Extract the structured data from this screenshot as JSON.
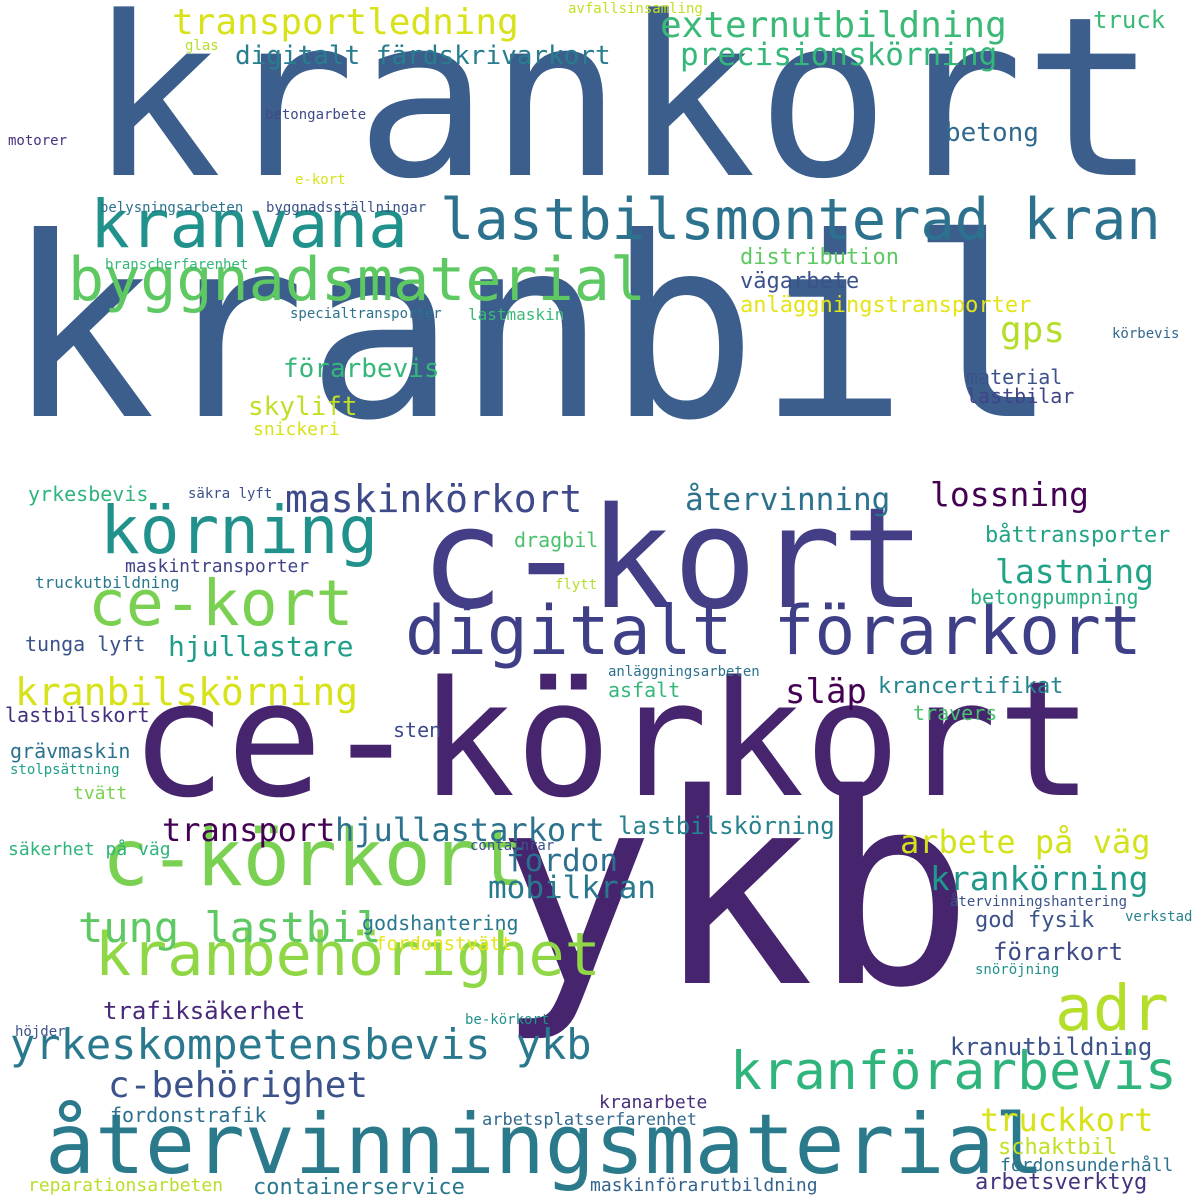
{
  "words": [
    {
      "id": "kranbil",
      "text": "kranbil",
      "color": "#3b5e8c"
    },
    {
      "id": "krankort",
      "text": "krankort",
      "color": "#3b5e8c"
    },
    {
      "id": "ykb",
      "text": "ykb",
      "color": "#46256e"
    },
    {
      "id": "ce-korkort",
      "text": "ce-körkort",
      "color": "#46256e"
    },
    {
      "id": "c-kort",
      "text": "c-kort",
      "color": "#433e85"
    },
    {
      "id": "digitalt-forarkort",
      "text": "digitalt förarkort",
      "color": "#3f3f87"
    },
    {
      "id": "atervinningsmaterial",
      "text": "återvinningsmaterial",
      "color": "#2a7a8c"
    },
    {
      "id": "lastbilsmonterad-kran",
      "text": "lastbilsmonterad kran",
      "color": "#2c728e"
    },
    {
      "id": "kranvana",
      "text": "kranvana",
      "color": "#21918c"
    },
    {
      "id": "byggnadsmaterial",
      "text": "byggnadsmaterial",
      "color": "#5ec962"
    },
    {
      "id": "korning",
      "text": "körning",
      "color": "#21918c"
    },
    {
      "id": "ce-kort",
      "text": "ce-kort",
      "color": "#7ad151"
    },
    {
      "id": "c-korkort",
      "text": "c-körkort",
      "color": "#7ad151"
    },
    {
      "id": "kranforarbevis",
      "text": "kranförarbevis",
      "color": "#2fb47c"
    },
    {
      "id": "adr",
      "text": "adr",
      "color": "#b5de2b"
    },
    {
      "id": "kranbehorighet",
      "text": "kranbehörighet",
      "color": "#8fd744"
    },
    {
      "id": "yrkeskompetensbevis-ykb",
      "text": "yrkeskompetensbevis ykb",
      "color": "#2a788e"
    },
    {
      "id": "tung-lastbil",
      "text": "tung lastbil",
      "color": "#5ec962"
    },
    {
      "id": "transportledning",
      "text": "transportledning",
      "color": "#d8e219"
    },
    {
      "id": "externutbildning",
      "text": "externutbildning",
      "color": "#3aba76"
    },
    {
      "id": "maskinkorkort",
      "text": "maskinkörkort",
      "color": "#3e4989"
    },
    {
      "id": "kranbilskorning",
      "text": "kranbilskörning",
      "color": "#d8e219"
    },
    {
      "id": "c-behorighet",
      "text": "c-behörighet",
      "color": "#3b528b"
    },
    {
      "id": "transport",
      "text": "transport",
      "color": "#440154"
    },
    {
      "id": "hjullastarkort",
      "text": "hjullastarkort",
      "color": "#2c728e"
    },
    {
      "id": "precisionskorning",
      "text": "precisionskörning",
      "color": "#35b779"
    },
    {
      "id": "digitalt-fardskrivarkort",
      "text": "digitalt färdskrivarkort",
      "color": "#287d8e"
    },
    {
      "id": "lossning",
      "text": "lossning",
      "color": "#440154"
    },
    {
      "id": "lastning",
      "text": "lastning",
      "color": "#20a386"
    },
    {
      "id": "atervinning",
      "text": "återvinning",
      "color": "#2c728e"
    },
    {
      "id": "krankorning",
      "text": "krankörning",
      "color": "#1f9a8a"
    },
    {
      "id": "arbete-pa-vag",
      "text": "arbete på väg",
      "color": "#d2e21b"
    },
    {
      "id": "truckkort",
      "text": "truckkort",
      "color": "#d8e219"
    },
    {
      "id": "mobilkran",
      "text": "mobilkran",
      "color": "#2a788e"
    },
    {
      "id": "fordon",
      "text": "fordon",
      "color": "#2d708e"
    },
    {
      "id": "hjullastare",
      "text": "hjullastare",
      "color": "#1f9e89"
    },
    {
      "id": "slap",
      "text": "släp",
      "color": "#440154"
    },
    {
      "id": "gps",
      "text": "gps",
      "color": "#b5de2b"
    },
    {
      "id": "forarbevis",
      "text": "förarbevis",
      "color": "#35b779"
    },
    {
      "id": "skylift",
      "text": "skylift",
      "color": "#c0df25"
    },
    {
      "id": "distribution",
      "text": "distribution",
      "color": "#5ec962"
    },
    {
      "id": "vagarbete",
      "text": "vägarbete",
      "color": "#3b528b"
    },
    {
      "id": "anlaggningstransporter",
      "text": "anläggningstransporter",
      "color": "#e5e419"
    },
    {
      "id": "betong",
      "text": "betong",
      "color": "#31688e"
    },
    {
      "id": "truck",
      "text": "truck",
      "color": "#3aba76"
    },
    {
      "id": "material",
      "text": "material",
      "color": "#3b528b"
    },
    {
      "id": "lastbilar",
      "text": "lastbilar",
      "color": "#414487"
    },
    {
      "id": "battransporter",
      "text": "båttransporter",
      "color": "#20a386"
    },
    {
      "id": "betongpumpning",
      "text": "betongpumpning",
      "color": "#29af7f"
    },
    {
      "id": "krancertifikat",
      "text": "krancertifikat",
      "color": "#24868e"
    },
    {
      "id": "travers",
      "text": "travers",
      "color": "#4ac16d"
    },
    {
      "id": "god-fysik",
      "text": "god fysik",
      "color": "#3b528b"
    },
    {
      "id": "forarkort",
      "text": "förarkort",
      "color": "#3e4a89"
    },
    {
      "id": "kranutbildning",
      "text": "kranutbildning",
      "color": "#3b528b"
    },
    {
      "id": "schaktbil",
      "text": "schaktbil",
      "color": "#c2df23"
    },
    {
      "id": "fordonsunderhall",
      "text": "fordonsunderhåll",
      "color": "#2c728e"
    },
    {
      "id": "arbetsverktyg",
      "text": "arbetsverktyg",
      "color": "#46327e"
    },
    {
      "id": "kranarbete",
      "text": "kranarbete",
      "color": "#472d7b"
    },
    {
      "id": "arbetsplatserfarenhet",
      "text": "arbetsplatserfarenhet",
      "color": "#31688e"
    },
    {
      "id": "maskinforarutbildning",
      "text": "maskinförarutbildning",
      "color": "#33638d"
    },
    {
      "id": "containerservice",
      "text": "containerservice",
      "color": "#2a788e"
    },
    {
      "id": "reparationsarbeten",
      "text": "reparationsarbeten",
      "color": "#b8de29"
    },
    {
      "id": "fordonstrafik",
      "text": "fordonstrafik",
      "color": "#2d708e"
    },
    {
      "id": "trafiksakerhet",
      "text": "trafiksäkerhet",
      "color": "#482878"
    },
    {
      "id": "lastbilskorning",
      "text": "lastbilskörning",
      "color": "#26828e"
    },
    {
      "id": "godshantering",
      "text": "godshantering",
      "color": "#2a788e"
    },
    {
      "id": "fordonstvatt",
      "text": "fordonstvätt",
      "color": "#e5e419"
    },
    {
      "id": "yrkesbevis",
      "text": "yrkesbevis",
      "color": "#2fb47c"
    },
    {
      "id": "sakra-lyft",
      "text": "säkra lyft",
      "color": "#3b528b"
    },
    {
      "id": "dragbil",
      "text": "dragbil",
      "color": "#4ac16d"
    },
    {
      "id": "maskintransporter",
      "text": "maskintransporter",
      "color": "#414487"
    },
    {
      "id": "truckutbildning",
      "text": "truckutbildning",
      "color": "#2a788e"
    },
    {
      "id": "flytt",
      "text": "flytt",
      "color": "#b5de2b"
    },
    {
      "id": "tunga-lyft",
      "text": "tunga lyft",
      "color": "#3b528b"
    },
    {
      "id": "anlaggningsarbeten",
      "text": "anläggningsarbeten",
      "color": "#2c728e"
    },
    {
      "id": "asfalt",
      "text": "asfalt",
      "color": "#35b779"
    },
    {
      "id": "lastbilskort",
      "text": "lastbilskort",
      "color": "#46307e"
    },
    {
      "id": "sten",
      "text": "sten",
      "color": "#3e4a89"
    },
    {
      "id": "gravmaskin",
      "text": "grävmaskin",
      "color": "#2c728e"
    },
    {
      "id": "stolpsattning",
      "text": "stolpsättning",
      "color": "#1fa088"
    },
    {
      "id": "tvatt",
      "text": "tvätt",
      "color": "#7ad151"
    },
    {
      "id": "sakerhet-pa-vag",
      "text": "säkerhet på väg",
      "color": "#2fb47c"
    },
    {
      "id": "containrar",
      "text": "containrar",
      "color": "#3b528b"
    },
    {
      "id": "atervinningshantering",
      "text": "återvinningshantering",
      "color": "#3b528b"
    },
    {
      "id": "verkstad",
      "text": "verkstad",
      "color": "#26828e"
    },
    {
      "id": "snorojning",
      "text": "snöröjning",
      "color": "#21918c"
    },
    {
      "id": "hojder",
      "text": "höjder",
      "color": "#3b528b"
    },
    {
      "id": "be-korkort",
      "text": "be-körkort",
      "color": "#21918c"
    },
    {
      "id": "avfallsinsamling",
      "text": "avfallsinsamling",
      "color": "#c2df23"
    },
    {
      "id": "glas",
      "text": "glas",
      "color": "#b5de2b"
    },
    {
      "id": "betongarbete",
      "text": "betongarbete",
      "color": "#3e4989"
    },
    {
      "id": "motorer",
      "text": "motorer",
      "color": "#46327e"
    },
    {
      "id": "e-kort",
      "text": "e-kort",
      "color": "#d8e219"
    },
    {
      "id": "belysningsarbeten",
      "text": "belysningsarbeten",
      "color": "#2c728e"
    },
    {
      "id": "byggnadsstallningar",
      "text": "byggnadsställningar",
      "color": "#3b528b"
    },
    {
      "id": "branscherfarenhet",
      "text": "branscherfarenhet",
      "color": "#35b779"
    },
    {
      "id": "specialtransporter",
      "text": "specialtransporter",
      "color": "#2c728e"
    },
    {
      "id": "lastmaskin",
      "text": "lastmaskin",
      "color": "#3aba76"
    },
    {
      "id": "korbevis",
      "text": "körbevis",
      "color": "#31688e"
    },
    {
      "id": "snickeri",
      "text": "snickeri",
      "color": "#d8e219"
    }
  ]
}
